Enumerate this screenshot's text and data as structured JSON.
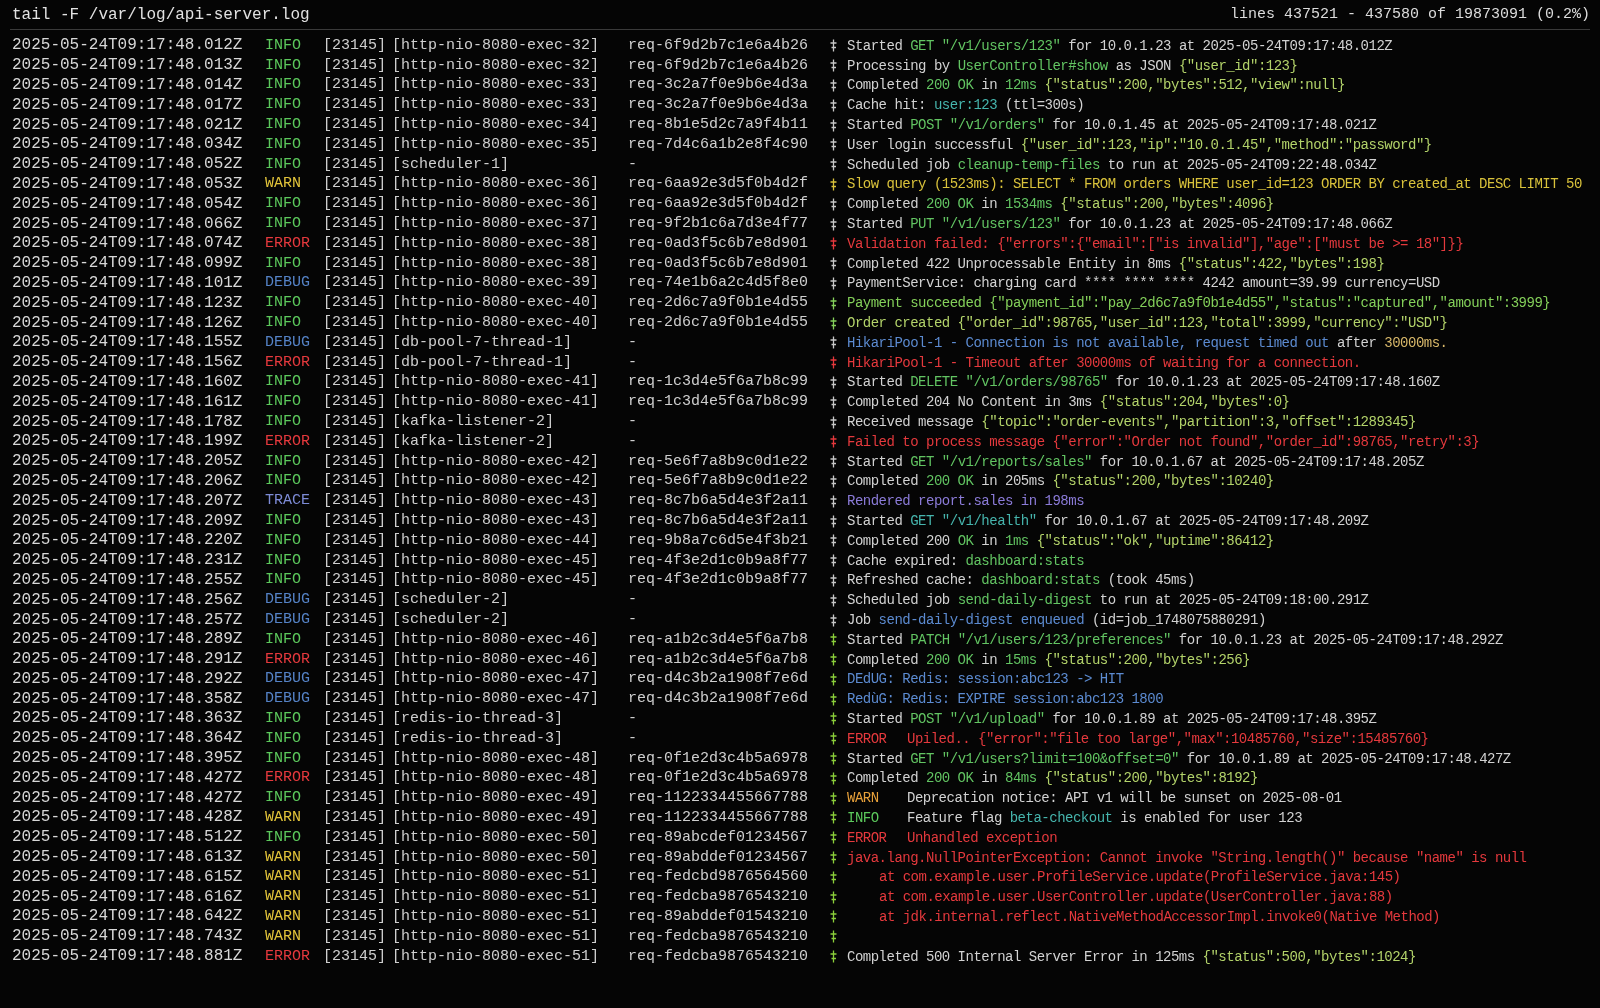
{
  "header": {
    "command": "tail -F /var/log/api-server.log",
    "position": "lines 437521 - 437580 of 19873091 (0.2%)"
  },
  "lines": [
    {
      "time": "2025-05-24T09:17:48.012Z",
      "level": "INFO",
      "kind": "info",
      "pid": "[23145]",
      "thread": "[http-nio-8080-exec-32]",
      "request": "req-6f9d2b7c1e6a4b26",
      "color": "#c8c8c8",
      "message": [
        {
          "text": "Started ",
          "kind": "plain"
        },
        {
          "text": "GET \"/v1/users/123\"",
          "kind": "green"
        },
        {
          "text": " for 10.0.1.23 at 2025-05-24T09:17:48.012Z",
          "kind": "plain"
        }
      ]
    },
    {
      "time": "2025-05-24T09:17:48.013Z",
      "level": "INFO",
      "kind": "info",
      "pid": "[23145]",
      "thread": "[http-nio-8080-exec-32]",
      "request": "req-6f9d2b7c1e6a4b26",
      "color": "#c8c8c8",
      "message": [
        {
          "text": "Processing by ",
          "kind": "plain"
        },
        {
          "text": "UserController#show",
          "kind": "green"
        },
        {
          "text": " as JSON ",
          "kind": "plain"
        },
        {
          "text": "{\"user_id\":123}",
          "kind": "json"
        }
      ]
    },
    {
      "time": "2025-05-24T09:17:48.014Z",
      "level": "INFO",
      "kind": "info",
      "pid": "[23145]",
      "thread": "[http-nio-8080-exec-33]",
      "request": "req-3c2a7f0e9b6e4d3a",
      "color": "#c8c8c8",
      "message": [
        {
          "text": "Completed ",
          "kind": "plain"
        },
        {
          "text": "200 OK",
          "kind": "green"
        },
        {
          "text": " in ",
          "kind": "plain"
        },
        {
          "text": "12ms",
          "kind": "green"
        },
        {
          "text": " {\"status\":200,\"bytes\":512,\"view\":null}",
          "kind": "json"
        }
      ]
    },
    {
      "time": "2025-05-24T09:17:48.017Z",
      "level": "INFO",
      "kind": "info",
      "pid": "[23145]",
      "thread": "[http-nio-8080-exec-33]",
      "request": "req-3c2a7f0e9b6e4d3a",
      "color": "#c8c8c8",
      "message": [
        {
          "text": "Cache hit: ",
          "kind": "plain"
        },
        {
          "text": "user:123",
          "kind": "teal"
        },
        {
          "text": " (ttl=300s)",
          "kind": "plain"
        }
      ]
    },
    {
      "time": "2025-05-24T09:17:48.021Z",
      "level": "INFO",
      "kind": "info",
      "pid": "[23145]",
      "thread": "[http-nio-8080-exec-34]",
      "request": "req-8b1e5d2c7a9f4b11",
      "color": "#c8c8c8",
      "message": [
        {
          "text": "Started ",
          "kind": "plain"
        },
        {
          "text": "POST \"/v1/orders\"",
          "kind": "green"
        },
        {
          "text": " for 10.0.1.45 at 2025-05-24T09:17:48.021Z",
          "kind": "plain"
        }
      ]
    },
    {
      "time": "2025-05-24T09:17:48.034Z",
      "level": "INFO",
      "kind": "info",
      "pid": "[23145]",
      "thread": "[http-nio-8080-exec-35]",
      "request": "req-7d4c6a1b2e8f4c90",
      "color": "#c8c8c8",
      "message": [
        {
          "text": "User login successful ",
          "kind": "plain"
        },
        {
          "text": "{\"user_id\":123,\"ip\":\"10.0.1.45\",\"method\":\"password\"}",
          "kind": "json"
        }
      ]
    },
    {
      "time": "2025-05-24T09:17:48.052Z",
      "level": "INFO",
      "kind": "info",
      "pid": "[23145]",
      "thread": "[scheduler-1]",
      "request": "-",
      "color": "#c8c8c8",
      "message": [
        {
          "text": "Scheduled job ",
          "kind": "plain"
        },
        {
          "text": "cleanup-temp-files",
          "kind": "green"
        },
        {
          "text": " to run at 2025-05-24T09:22:48.034Z",
          "kind": "plain"
        }
      ]
    },
    {
      "time": "2025-05-24T09:17:48.053Z",
      "level": "WARN",
      "kind": "warn",
      "pid": "[23145]",
      "thread": "[http-nio-8080-exec-36]",
      "request": "req-6aa92e3d5f0b4d2f",
      "color": "#d9c23b",
      "message": [
        {
          "text": "Slow query (1523ms): SELECT * FROM orders WHERE user_id=123 ORDER BY created_at DESC LIMIT 50",
          "kind": "yellow"
        }
      ]
    },
    {
      "time": "2025-05-24T09:17:48.054Z",
      "level": "INFO",
      "kind": "info",
      "pid": "[23145]",
      "thread": "[http-nio-8080-exec-36]",
      "request": "req-6aa92e3d5f0b4d2f",
      "color": "#c8c8c8",
      "message": [
        {
          "text": "Completed ",
          "kind": "plain"
        },
        {
          "text": "200 OK",
          "kind": "green"
        },
        {
          "text": " in ",
          "kind": "plain"
        },
        {
          "text": "1534ms",
          "kind": "green"
        },
        {
          "text": " {\"status\":200,\"bytes\":4096}",
          "kind": "json"
        }
      ]
    },
    {
      "time": "2025-05-24T09:17:48.066Z",
      "level": "INFO",
      "kind": "info",
      "pid": "[23145]",
      "thread": "[http-nio-8080-exec-37]",
      "request": "req-9f2b1c6a7d3e4f77",
      "color": "#c8c8c8",
      "message": [
        {
          "text": "Started ",
          "kind": "plain"
        },
        {
          "text": "PUT \"/v1/users/123\"",
          "kind": "green"
        },
        {
          "text": " for 10.0.1.23 at 2025-05-24T09:17:48.066Z",
          "kind": "plain"
        }
      ]
    },
    {
      "time": "2025-05-24T09:17:48.074Z",
      "level": "ERROR",
      "kind": "error",
      "pid": "[23145]",
      "thread": "[http-nio-8080-exec-38]",
      "request": "req-0ad3f5c6b7e8d901",
      "color": "#e5393d",
      "message": [
        {
          "text": "Validation failed: {\"errors\":{\"email\":[\"is invalid\"],\"age\":[\"must be >= 18\"]}}",
          "kind": "red"
        }
      ]
    },
    {
      "time": "2025-05-24T09:17:48.099Z",
      "level": "INFO",
      "kind": "info",
      "pid": "[23145]",
      "thread": "[http-nio-8080-exec-38]",
      "request": "req-0ad3f5c6b7e8d901",
      "color": "#c8c8c8",
      "message": [
        {
          "text": "Completed 422 Unprocessable Entity in 8ms ",
          "kind": "plain"
        },
        {
          "text": "{\"status\":422,\"bytes\":198}",
          "kind": "json"
        }
      ]
    },
    {
      "time": "2025-05-24T09:17:48.101Z",
      "level": "DEBUG",
      "kind": "debug",
      "pid": "[23145]",
      "thread": "[http-nio-8080-exec-39]",
      "request": "req-74e1b6a2c4d5f8e0",
      "color": "#c8c8c8",
      "message": [
        {
          "text": "PaymentService: charging card **** **** **** 4242 amount=39.99 currency=USD",
          "kind": "plain"
        }
      ]
    },
    {
      "time": "2025-05-24T09:17:48.123Z",
      "level": "INFO",
      "kind": "info",
      "pid": "[23145]",
      "thread": "[http-nio-8080-exec-40]",
      "request": "req-2d6c7a9f0b1e4d55",
      "color": "#84d05a",
      "message": [
        {
          "text": "Payment succeeded {\"payment_id\":\"pay_2d6c7a9f0b1e4d55\",\"status\":\"captured\",\"amount\":3999}",
          "kind": "success"
        }
      ]
    },
    {
      "time": "2025-05-24T09:17:48.126Z",
      "level": "INFO",
      "kind": "info",
      "pid": "[23145]",
      "thread": "[http-nio-8080-exec-40]",
      "request": "req-2d6c7a9f0b1e4d55",
      "color": "#84d05a",
      "message": [
        {
          "text": "Order created {\"order_id\":98765,\"user_id\":123,\"total\":3999,\"currency\":\"USD\"}",
          "kind": "json"
        }
      ]
    },
    {
      "time": "2025-05-24T09:17:48.155Z",
      "level": "DEBUG",
      "kind": "debug",
      "pid": "[23145]",
      "thread": "[db-pool-7-thread-1]",
      "request": "-",
      "color": "#c8c8c8",
      "message": [
        {
          "text": "HikariPool-1 - Connection is not available, request timed out",
          "kind": "blue"
        },
        {
          "text": " after ",
          "kind": "plain"
        },
        {
          "text": "30000ms.",
          "kind": "tan"
        }
      ]
    },
    {
      "time": "2025-05-24T09:17:48.156Z",
      "level": "ERROR",
      "kind": "error",
      "pid": "[23145]",
      "thread": "[db-pool-7-thread-1]",
      "request": "-",
      "color": "#e5393d",
      "message": [
        {
          "text": "HikariPool-1 - Timeout after 30000ms of waiting for a connection.",
          "kind": "red"
        }
      ]
    },
    {
      "time": "2025-05-24T09:17:48.160Z",
      "level": "INFO",
      "kind": "info",
      "pid": "[23145]",
      "thread": "[http-nio-8080-exec-41]",
      "request": "req-1c3d4e5f6a7b8c99",
      "color": "#c8c8c8",
      "message": [
        {
          "text": "Started ",
          "kind": "plain"
        },
        {
          "text": "DELETE \"/v1/orders/98765\"",
          "kind": "green"
        },
        {
          "text": " for 10.0.1.23 at 2025-05-24T09:17:48.160Z",
          "kind": "plain"
        }
      ]
    },
    {
      "time": "2025-05-24T09:17:48.161Z",
      "level": "INFO",
      "kind": "info",
      "pid": "[23145]",
      "thread": "[http-nio-8080-exec-41]",
      "request": "req-1c3d4e5f6a7b8c99",
      "color": "#c8c8c8",
      "message": [
        {
          "text": "Completed 204 No Content in 3ms ",
          "kind": "plain"
        },
        {
          "text": "{\"status\":204,\"bytes\":0}",
          "kind": "json"
        }
      ]
    },
    {
      "time": "2025-05-24T09:17:48.178Z",
      "level": "INFO",
      "kind": "info",
      "pid": "[23145]",
      "thread": "[kafka-listener-2]",
      "request": "-",
      "color": "#c8c8c8",
      "message": [
        {
          "text": "Received message ",
          "kind": "plain"
        },
        {
          "text": "{\"topic\":\"order-events\",\"partition\":3,\"offset\":1289345}",
          "kind": "json"
        }
      ]
    },
    {
      "time": "2025-05-24T09:17:48.199Z",
      "level": "ERROR",
      "kind": "error",
      "pid": "[23145]",
      "thread": "[kafka-listener-2]",
      "request": "-",
      "color": "#e5393d",
      "message": [
        {
          "text": "Failed to process message {\"error\":\"Order not found\",\"order_id\":98765,\"retry\":3}",
          "kind": "red"
        }
      ]
    },
    {
      "time": "2025-05-24T09:17:48.205Z",
      "level": "INFO",
      "kind": "info",
      "pid": "[23145]",
      "thread": "[http-nio-8080-exec-42]",
      "request": "req-5e6f7a8b9c0d1e22",
      "color": "#c8c8c8",
      "message": [
        {
          "text": "Started ",
          "kind": "plain"
        },
        {
          "text": "GET \"/v1/reports/sales\"",
          "kind": "green"
        },
        {
          "text": " for 10.0.1.67 at 2025-05-24T09:17:48.205Z",
          "kind": "plain"
        }
      ]
    },
    {
      "time": "2025-05-24T09:17:48.206Z",
      "level": "INFO",
      "kind": "info",
      "pid": "[23145]",
      "thread": "[http-nio-8080-exec-42]",
      "request": "req-5e6f7a8b9c0d1e22",
      "color": "#c8c8c8",
      "message": [
        {
          "text": "Completed ",
          "kind": "plain"
        },
        {
          "text": "200 OK",
          "kind": "green"
        },
        {
          "text": " in 205ms ",
          "kind": "plain"
        },
        {
          "text": "{\"status\":200,\"bytes\":10240}",
          "kind": "json"
        }
      ]
    },
    {
      "time": "2025-05-24T09:17:48.207Z",
      "level": "TRACE",
      "kind": "trace",
      "pid": "[23145]",
      "thread": "[http-nio-8080-exec-43]",
      "request": "req-8c7b6a5d4e3f2a11",
      "color": "#c8c8c8",
      "message": [
        {
          "text": "Rendered report.sales in 198ms",
          "kind": "purple"
        }
      ]
    },
    {
      "time": "2025-05-24T09:17:48.209Z",
      "level": "INFO",
      "kind": "info",
      "pid": "[23145]",
      "thread": "[http-nio-8080-exec-43]",
      "request": "req-8c7b6a5d4e3f2a11",
      "color": "#c8c8c8",
      "message": [
        {
          "text": "Started ",
          "kind": "plain"
        },
        {
          "text": "GET \"/v1/health\"",
          "kind": "teal"
        },
        {
          "text": " for 10.0.1.67 at 2025-05-24T09:17:48.209Z",
          "kind": "plain"
        }
      ]
    },
    {
      "time": "2025-05-24T09:17:48.220Z",
      "level": "INFO",
      "kind": "info",
      "pid": "[23145]",
      "thread": "[http-nio-8080-exec-44]",
      "request": "req-9b8a7c6d5e4f3b21",
      "color": "#c8c8c8",
      "message": [
        {
          "text": "Completed 200 ",
          "kind": "plain"
        },
        {
          "text": "OK",
          "kind": "green"
        },
        {
          "text": " in ",
          "kind": "plain"
        },
        {
          "text": "1ms",
          "kind": "green"
        },
        {
          "text": " {\"status\":\"ok\",\"uptime\":86412}",
          "kind": "json"
        }
      ]
    },
    {
      "time": "2025-05-24T09:17:48.231Z",
      "level": "INFO",
      "kind": "info",
      "pid": "[23145]",
      "thread": "[http-nio-8080-exec-45]",
      "request": "req-4f3e2d1c0b9a8f77",
      "color": "#c8c8c8",
      "message": [
        {
          "text": "Cache expired: ",
          "kind": "plain"
        },
        {
          "text": "dashboard:stats",
          "kind": "green"
        }
      ]
    },
    {
      "time": "2025-05-24T09:17:48.255Z",
      "level": "INFO",
      "kind": "info",
      "pid": "[23145]",
      "thread": "[http-nio-8080-exec-45]",
      "request": "req-4f3e2d1c0b9a8f77",
      "color": "#c8c8c8",
      "message": [
        {
          "text": "Refreshed cache: ",
          "kind": "plain"
        },
        {
          "text": "dashboard:stats",
          "kind": "green"
        },
        {
          "text": " (took 45ms)",
          "kind": "plain"
        }
      ]
    },
    {
      "time": "2025-05-24T09:17:48.256Z",
      "level": "DEBUG",
      "kind": "debug",
      "pid": "[23145]",
      "thread": "[scheduler-2]",
      "request": "-",
      "color": "#c8c8c8",
      "message": [
        {
          "text": "Scheduled job ",
          "kind": "plain"
        },
        {
          "text": "send-daily-digest",
          "kind": "green"
        },
        {
          "text": " to run at 2025-05-24T09:18:00.291Z",
          "kind": "plain"
        }
      ]
    },
    {
      "time": "2025-05-24T09:17:48.257Z",
      "level": "DEBUG",
      "kind": "debug",
      "pid": "[23145]",
      "thread": "[scheduler-2]",
      "request": "-",
      "color": "#c8c8c8",
      "message": [
        {
          "text": "Job ",
          "kind": "plain"
        },
        {
          "text": "send-daily-digest enqueued",
          "kind": "blue"
        },
        {
          "text": " (id=job_1748075880291)",
          "kind": "plain"
        }
      ]
    },
    {
      "time": "2025-05-24T09:17:48.289Z",
      "level": "INFO",
      "kind": "info",
      "pid": "[23145]",
      "thread": "[http-nio-8080-exec-46]",
      "request": "req-a1b2c3d4e5f6a7b8",
      "color": "#8bcf3a",
      "message": [
        {
          "text": "Started ",
          "kind": "plain"
        },
        {
          "text": "PATCH \"/v1/users/123/preferences\"",
          "kind": "green"
        },
        {
          "text": " for 10.0.1.23 at 2025-05-24T09:17:48.292Z",
          "kind": "plain"
        }
      ]
    },
    {
      "time": "2025-05-24T09:17:48.291Z",
      "level": "ERROR",
      "kind": "error",
      "pid": "[23145]",
      "thread": "[http-nio-8080-exec-46]",
      "request": "req-a1b2c3d4e5f6a7b8",
      "color": "#8bcf3a",
      "message": [
        {
          "text": "Completed ",
          "kind": "plain"
        },
        {
          "text": "200 OK",
          "kind": "green"
        },
        {
          "text": " in ",
          "kind": "plain"
        },
        {
          "text": "15ms",
          "kind": "green"
        },
        {
          "text": " {\"status\":200,\"bytes\":256}",
          "kind": "json"
        }
      ]
    },
    {
      "time": "2025-05-24T09:17:48.292Z",
      "level": "DEBUG",
      "kind": "debug",
      "pid": "[23145]",
      "thread": "[http-nio-8080-exec-47]",
      "request": "req-d4c3b2a1908f7e6d",
      "color": "#8bcf3a",
      "message": [
        {
          "text": "DEdUG: Redis: session:abc123 -> HIT",
          "kind": "blue"
        }
      ]
    },
    {
      "time": "2025-05-24T09:17:48.358Z",
      "level": "DEBUG",
      "kind": "debug",
      "pid": "[23145]",
      "thread": "[http-nio-8080-exec-47]",
      "request": "req-d4c3b2a1908f7e6d",
      "color": "#8bcf3a",
      "message": [
        {
          "text": "RedùG: Redis: EXPIRE session:abc123 1800",
          "kind": "blue"
        }
      ]
    },
    {
      "time": "2025-05-24T09:17:48.363Z",
      "level": "INFO",
      "kind": "info",
      "pid": "[23145]",
      "thread": "[redis-io-thread-3]",
      "request": "-",
      "color": "#8bcf3a",
      "message": [
        {
          "text": "Started ",
          "kind": "plain"
        },
        {
          "text": "POST \"/v1/upload\"",
          "kind": "green"
        },
        {
          "text": " for 10.0.1.89 at 2025-05-24T09:17:48.395Z",
          "kind": "plain"
        }
      ]
    },
    {
      "time": "2025-05-24T09:17:48.364Z",
      "level": "INFO",
      "kind": "info",
      "pid": "[23145]",
      "thread": "[redis-io-thread-3]",
      "request": "-",
      "color": "#8bcf3a",
      "message": [
        {
          "text": "ERROR",
          "kind": "tag_error"
        },
        {
          "text": "Upiled.. {\"error\":\"file too large\",\"max\":10485760,\"size\":15485760}",
          "kind": "red"
        }
      ]
    },
    {
      "time": "2025-05-24T09:17:48.395Z",
      "level": "INFO",
      "kind": "info",
      "pid": "[23145]",
      "thread": "[http-nio-8080-exec-48]",
      "request": "req-0f1e2d3c4b5a6978",
      "color": "#8bcf3a",
      "message": [
        {
          "text": "Started ",
          "kind": "plain"
        },
        {
          "text": "GET \"/v1/users?limit=100&offset=0\"",
          "kind": "green"
        },
        {
          "text": " for 10.0.1.89 at 2025-05-24T09:17:48.427Z",
          "kind": "plain"
        }
      ]
    },
    {
      "time": "2025-05-24T09:17:48.427Z",
      "level": "ERROR",
      "kind": "error",
      "pid": "[23145]",
      "thread": "[http-nio-8080-exec-48]",
      "request": "req-0f1e2d3c4b5a6978",
      "color": "#8bcf3a",
      "message": [
        {
          "text": "Completed ",
          "kind": "plain"
        },
        {
          "text": "200 OK",
          "kind": "green"
        },
        {
          "text": " in ",
          "kind": "plain"
        },
        {
          "text": "84ms",
          "kind": "green"
        },
        {
          "text": " {\"status\":200,\"bytes\":8192}",
          "kind": "json"
        }
      ]
    },
    {
      "time": "2025-05-24T09:17:48.427Z",
      "level": "INFO",
      "kind": "info",
      "pid": "[23145]",
      "thread": "[http-nio-8080-exec-49]",
      "request": "req-1122334455667788",
      "color": "#8bcf3a",
      "message": [
        {
          "text": "WARN",
          "kind": "tag_warn"
        },
        {
          "text": "Deprecation notice: API v1 will be sunset on 2025-08-01",
          "kind": "plain"
        }
      ]
    },
    {
      "time": "2025-05-24T09:17:48.428Z",
      "level": "WARN",
      "kind": "warn",
      "pid": "[23145]",
      "thread": "[http-nio-8080-exec-49]",
      "request": "req-1122334455667788",
      "color": "#8bcf3a",
      "message": [
        {
          "text": "INFO",
          "kind": "tag_info"
        },
        {
          "text": "Feature flag ",
          "kind": "plain"
        },
        {
          "text": "beta-checkout",
          "kind": "teal"
        },
        {
          "text": " is enabled for user 123",
          "kind": "plain"
        }
      ]
    },
    {
      "time": "2025-05-24T09:17:48.512Z",
      "level": "INFO",
      "kind": "info",
      "pid": "[23145]",
      "thread": "[http-nio-8080-exec-50]",
      "request": "req-89abcdef01234567",
      "color": "#8bcf3a",
      "message": [
        {
          "text": "ERROR",
          "kind": "tag_error"
        },
        {
          "text": "Unhandled exception",
          "kind": "red"
        }
      ]
    },
    {
      "time": "2025-05-24T09:17:48.613Z",
      "level": "WARN",
      "kind": "warn",
      "pid": "[23145]",
      "thread": "[http-nio-8080-exec-50]",
      "request": "req-89abddef01234567",
      "color": "#8bcf3a",
      "message": [
        {
          "text": "java.lang.NullPointerException: Cannot invoke \"String.length()\" because \"name\" is null",
          "kind": "red"
        }
      ]
    },
    {
      "time": "2025-05-24T09:17:48.615Z",
      "level": "WARN",
      "kind": "warn",
      "pid": "[23145]",
      "thread": "[http-nio-8080-exec-51]",
      "request": "req-fedcbd9876564560",
      "color": "#8bcf3a",
      "message": [
        {
          "text": "at com.example.user.ProfileService.update(ProfileService.java:145)",
          "kind": "stack"
        }
      ]
    },
    {
      "time": "2025-05-24T09:17:48.616Z",
      "level": "WARN",
      "kind": "warn",
      "pid": "[23145]",
      "thread": "[http-nio-8080-exec-51]",
      "request": "req-fedcba9876543210",
      "color": "#8bcf3a",
      "message": [
        {
          "text": "at com.example.user.UserController.update(UserController.java:88)",
          "kind": "stack"
        }
      ]
    },
    {
      "time": "2025-05-24T09:17:48.642Z",
      "level": "WARN",
      "kind": "warn",
      "pid": "[23145]",
      "thread": "[http-nio-8080-exec-51]",
      "request": "req-89abddef01543210",
      "color": "#8bcf3a",
      "message": [
        {
          "text": "at jdk.internal.reflect.NativeMethodAccessorImpl.invoke0(Native Method)",
          "kind": "stack"
        }
      ]
    },
    {
      "time": "2025-05-24T09:17:48.743Z",
      "level": "WARN",
      "kind": "warn",
      "pid": "[23145]",
      "thread": "[http-nio-8080-exec-51]",
      "request": "req-fedcba9876543210",
      "color": "#8bcf3a"
    },
    {
      "time": "2025-05-24T09:17:48.881Z",
      "level": "ERROR",
      "kind": "error",
      "pid": "[23145]",
      "thread": "[http-nio-8080-exec-51]",
      "request": "req-fedcba9876543210",
      "color": "#8bcf3a",
      "message": [
        {
          "text": "Completed 500 Internal Server Error in 125ms ",
          "kind": "plain"
        },
        {
          "text": "{\"status\":500,\"bytes\":1024}",
          "kind": "json"
        }
      ]
    }
  ]
}
